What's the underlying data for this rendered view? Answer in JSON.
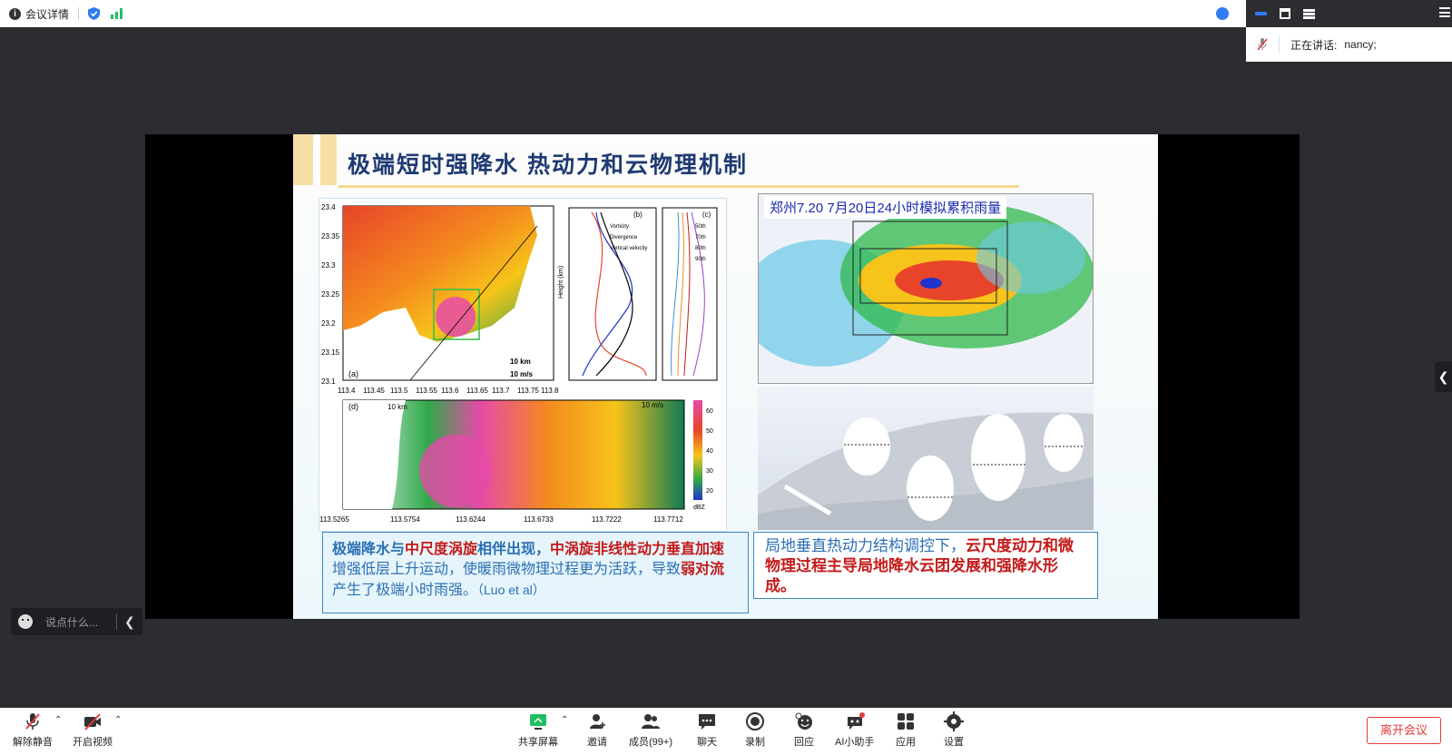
{
  "topbar": {
    "meeting_details": "会议详情",
    "info_icon_glyph": "i"
  },
  "right_panel": {
    "speaking_label": "正在讲话:",
    "speaking_name": "nancy;"
  },
  "slide": {
    "title": "极端短时强降水 热动力和云物理机制",
    "right_top_caption": "郑州7.20 7月20日24小时模拟累积雨量",
    "left_text": {
      "p1_blue": "极端降水与",
      "p1_red": "中尺度涡旋",
      "p1_blue2": "相伴出现，",
      "p1_red2": "中涡旋非线性动力垂直加速",
      "p2": "增强低层上升运动，使暖雨微物理过程更为活跃，导致",
      "p2_red": "弱对流",
      "p2_end": "产生了极端小时雨强。",
      "cite": "（Luo et al）"
    },
    "right_text": {
      "plain": "局地垂直热动力结构调控下，",
      "red": "云尺度动力和微物理过程主导局地降水云团发展和强降水形成。"
    },
    "fig_labels": {
      "a": "(a)",
      "b": "(b)",
      "c": "(c)",
      "d": "(d)",
      "km10": "10 km",
      "ms10": "10 m/s",
      "lat": [
        "23.4",
        "23.35",
        "23.3",
        "23.25",
        "23.2",
        "23.15",
        "23.1"
      ],
      "lon": [
        "113.4",
        "113.45",
        "113.5",
        "113.55",
        "113.6",
        "113.65",
        "113.7",
        "113.75",
        "113.8"
      ],
      "lon2": [
        "113.5265",
        "113.5754",
        "113.6244",
        "113.6733",
        "113.7222",
        "113.7712"
      ],
      "dbz": [
        "60",
        "50",
        "40",
        "30",
        "20",
        "dBZ"
      ],
      "legend_b": [
        "Vorticity",
        "Divergence",
        "Vertical velocity"
      ],
      "legend_c": [
        "50th",
        "70th",
        "80th",
        "90th"
      ],
      "height_label": "Height (km)"
    }
  },
  "chat": {
    "placeholder": "说点什么..."
  },
  "toolbar": {
    "unmute": "解除静音",
    "start_video": "开启视频",
    "share_screen": "共享屏幕",
    "invite": "邀请",
    "members": "成员(99+)",
    "chat": "聊天",
    "record": "录制",
    "react": "回应",
    "ai_assistant": "AI小助手",
    "apps": "应用",
    "settings": "设置",
    "leave": "离开会议"
  },
  "colors": {
    "accent": "#2f7cf6",
    "leave": "#e23b3b",
    "signal": "#1fbf62"
  }
}
